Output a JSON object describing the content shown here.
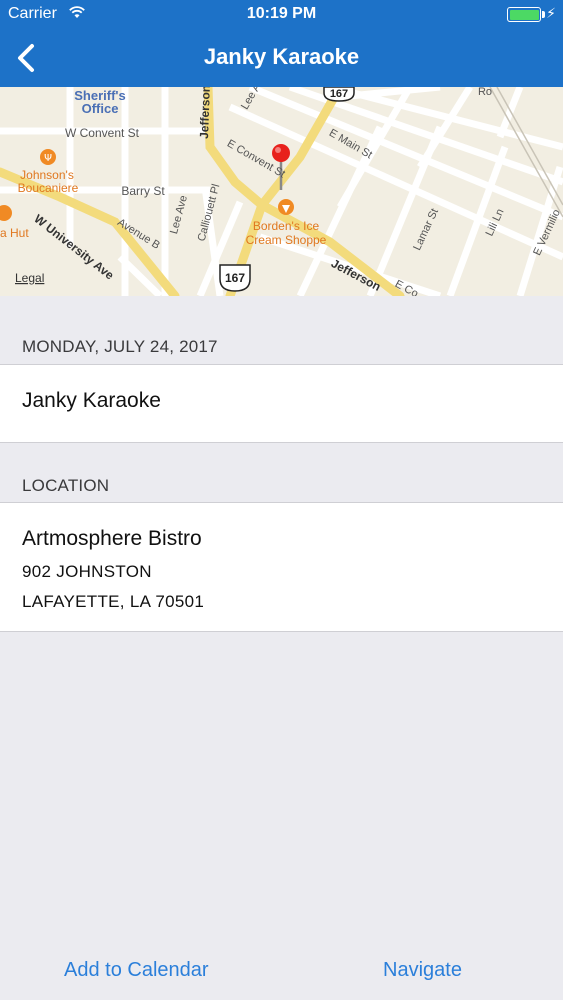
{
  "status_bar": {
    "carrier": "Carrier",
    "time": "10:19 PM",
    "battery_color": "#4CD964"
  },
  "nav": {
    "back_icon": "chevron-left-icon",
    "title": "Janky Karaoke",
    "bar_color": "#1D72C8"
  },
  "map": {
    "labels": {
      "sheriff_1": "Sheriff's",
      "sheriff_2": "Office",
      "convent_w": "W Convent St",
      "johnsons_1": "Johnson's",
      "johnsons_2": "Boucaniere",
      "barry": "Barry St",
      "university": "W University Ave",
      "hut": "a Hut",
      "avenue_b": "Avenue B",
      "lee": "Lee Ave",
      "calliouett": "Calliouett Pl",
      "jefferson_top": "Jefferson",
      "convent_e": "E Convent St",
      "main": "E Main St",
      "bordens_1": "Borden's Ice",
      "bordens_2": "Cream Shoppe",
      "lamar": "Lamar St",
      "lili": "Lili Ln",
      "vermilion": "E Vermilio",
      "jefferson_bottom": "Jefferson",
      "co": "E Co",
      "route_top": "167",
      "route_bottom": "167",
      "legal": "Legal",
      "lee_top": "Lee A",
      "ro": "Ro"
    },
    "pin_color": "#E8211C",
    "poi_color": "#F08A24"
  },
  "event": {
    "date_header": "MONDAY, JULY 24, 2017",
    "name": "Janky Karaoke"
  },
  "location": {
    "header": "LOCATION",
    "venue": "Artmosphere Bistro",
    "address_line1": "902 JOHNSTON",
    "address_line2": "LAFAYETTE, LA 70501"
  },
  "toolbar": {
    "add_to_calendar": "Add to Calendar",
    "navigate": "Navigate",
    "link_color": "#2B7FDA"
  }
}
